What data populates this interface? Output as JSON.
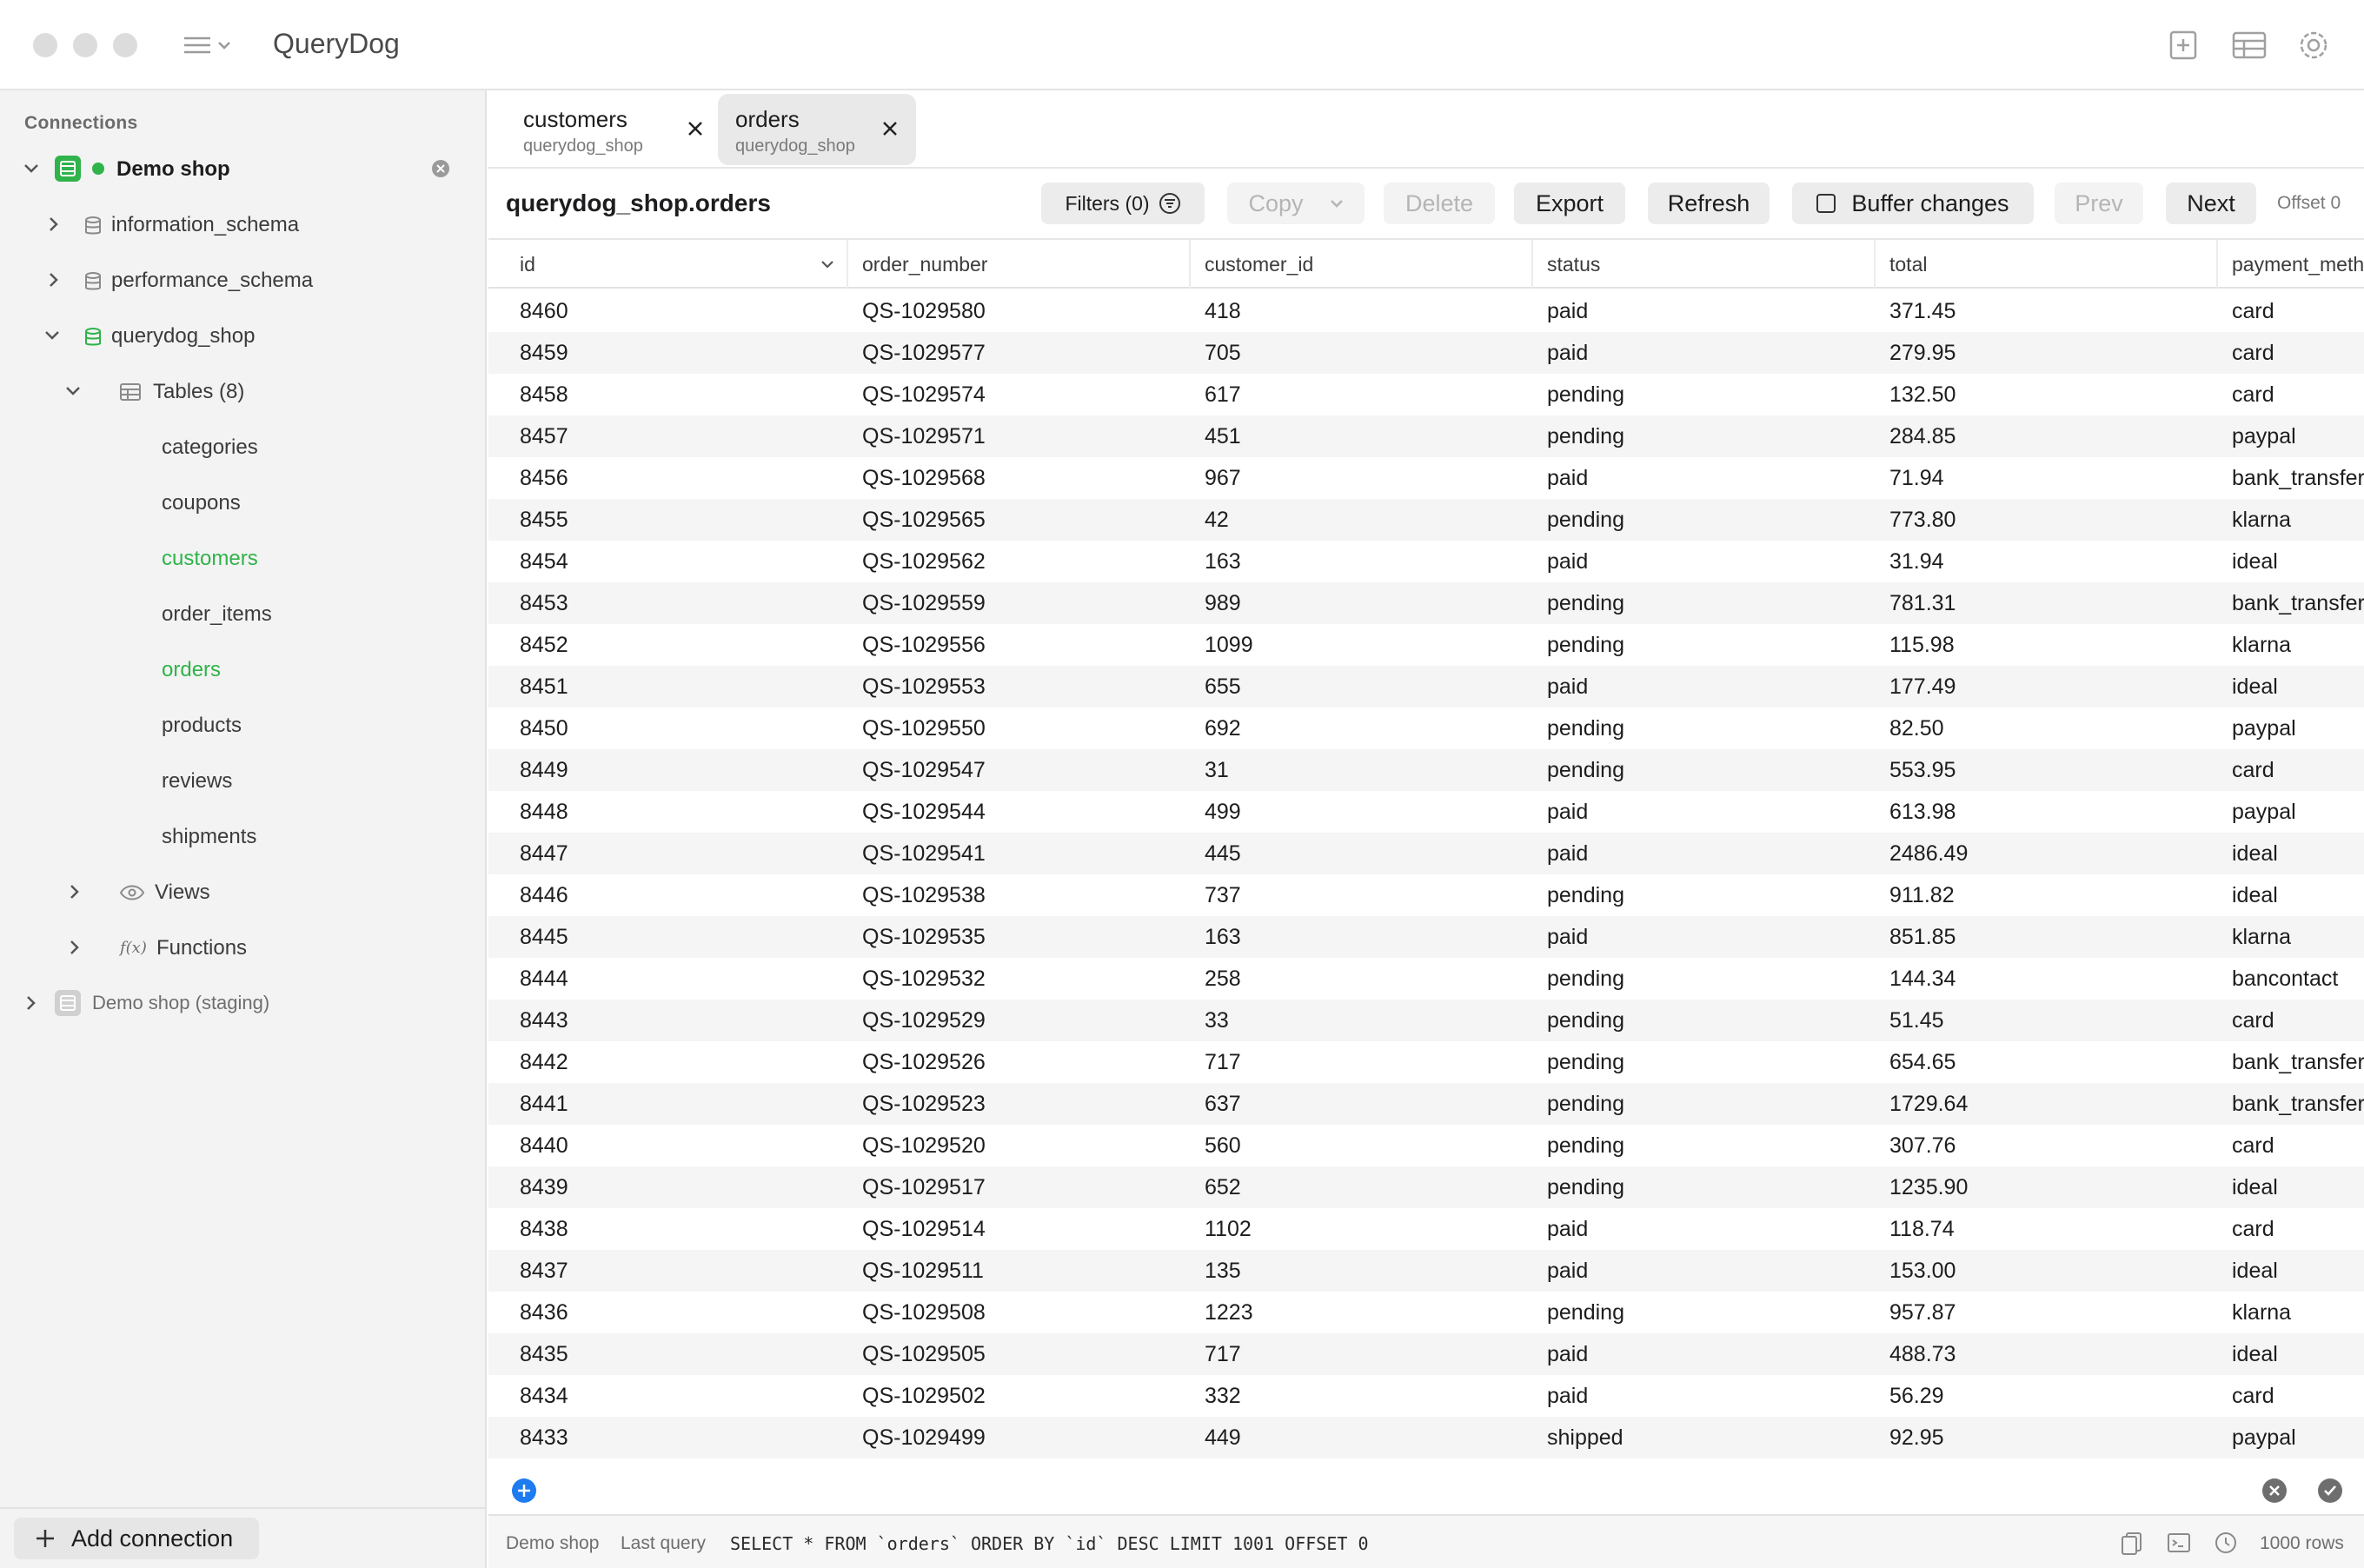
{
  "app": {
    "title": "QueryDog"
  },
  "colors": {
    "accent": "#2fb34a",
    "blue": "#1e7bf0",
    "altRow": "#f5f5f5"
  },
  "sidebar": {
    "header": "Connections",
    "connection": {
      "name": "Demo shop",
      "status": "connected"
    },
    "schemas": [
      "information_schema",
      "performance_schema",
      "querydog_shop"
    ],
    "tables_label": "Tables (8)",
    "tables": [
      "categories",
      "coupons",
      "customers",
      "order_items",
      "orders",
      "products",
      "reviews",
      "shipments"
    ],
    "views_label": "Views",
    "functions_label": "Functions",
    "fx_glyph": "f(x)",
    "staging": "Demo shop (staging)",
    "add_connection": "Add connection"
  },
  "tabs": [
    {
      "title": "customers",
      "sub": "querydog_shop"
    },
    {
      "title": "orders",
      "sub": "querydog_shop"
    }
  ],
  "toolbar": {
    "table_name": "querydog_shop.orders",
    "filters": "Filters (0)",
    "copy": "Copy",
    "delete": "Delete",
    "export": "Export",
    "refresh": "Refresh",
    "buffer": "Buffer changes",
    "prev": "Prev",
    "next": "Next",
    "offset": "Offset 0"
  },
  "table": {
    "columns": [
      "id",
      "order_number",
      "customer_id",
      "status",
      "total",
      "payment_meth"
    ],
    "rows": [
      [
        "8460",
        "QS-1029580",
        "418",
        "paid",
        "371.45",
        "card"
      ],
      [
        "8459",
        "QS-1029577",
        "705",
        "paid",
        "279.95",
        "card"
      ],
      [
        "8458",
        "QS-1029574",
        "617",
        "pending",
        "132.50",
        "card"
      ],
      [
        "8457",
        "QS-1029571",
        "451",
        "pending",
        "284.85",
        "paypal"
      ],
      [
        "8456",
        "QS-1029568",
        "967",
        "paid",
        "71.94",
        "bank_transfer"
      ],
      [
        "8455",
        "QS-1029565",
        "42",
        "pending",
        "773.80",
        "klarna"
      ],
      [
        "8454",
        "QS-1029562",
        "163",
        "paid",
        "31.94",
        "ideal"
      ],
      [
        "8453",
        "QS-1029559",
        "989",
        "pending",
        "781.31",
        "bank_transfer"
      ],
      [
        "8452",
        "QS-1029556",
        "1099",
        "pending",
        "115.98",
        "klarna"
      ],
      [
        "8451",
        "QS-1029553",
        "655",
        "paid",
        "177.49",
        "ideal"
      ],
      [
        "8450",
        "QS-1029550",
        "692",
        "pending",
        "82.50",
        "paypal"
      ],
      [
        "8449",
        "QS-1029547",
        "31",
        "pending",
        "553.95",
        "card"
      ],
      [
        "8448",
        "QS-1029544",
        "499",
        "paid",
        "613.98",
        "paypal"
      ],
      [
        "8447",
        "QS-1029541",
        "445",
        "paid",
        "2486.49",
        "ideal"
      ],
      [
        "8446",
        "QS-1029538",
        "737",
        "pending",
        "911.82",
        "ideal"
      ],
      [
        "8445",
        "QS-1029535",
        "163",
        "paid",
        "851.85",
        "klarna"
      ],
      [
        "8444",
        "QS-1029532",
        "258",
        "pending",
        "144.34",
        "bancontact"
      ],
      [
        "8443",
        "QS-1029529",
        "33",
        "pending",
        "51.45",
        "card"
      ],
      [
        "8442",
        "QS-1029526",
        "717",
        "pending",
        "654.65",
        "bank_transfer"
      ],
      [
        "8441",
        "QS-1029523",
        "637",
        "pending",
        "1729.64",
        "bank_transfer"
      ],
      [
        "8440",
        "QS-1029520",
        "560",
        "pending",
        "307.76",
        "card"
      ],
      [
        "8439",
        "QS-1029517",
        "652",
        "pending",
        "1235.90",
        "ideal"
      ],
      [
        "8438",
        "QS-1029514",
        "1102",
        "paid",
        "118.74",
        "card"
      ],
      [
        "8437",
        "QS-1029511",
        "135",
        "paid",
        "153.00",
        "ideal"
      ],
      [
        "8436",
        "QS-1029508",
        "1223",
        "pending",
        "957.87",
        "klarna"
      ],
      [
        "8435",
        "QS-1029505",
        "717",
        "paid",
        "488.73",
        "ideal"
      ],
      [
        "8434",
        "QS-1029502",
        "332",
        "paid",
        "56.29",
        "card"
      ],
      [
        "8433",
        "QS-1029499",
        "449",
        "shipped",
        "92.95",
        "paypal"
      ]
    ]
  },
  "status_bar": {
    "connection": "Demo shop",
    "last_query_label": "Last query",
    "query": "SELECT * FROM `orders` ORDER BY `id` DESC LIMIT 1001 OFFSET 0",
    "row_count": "1000 rows"
  }
}
